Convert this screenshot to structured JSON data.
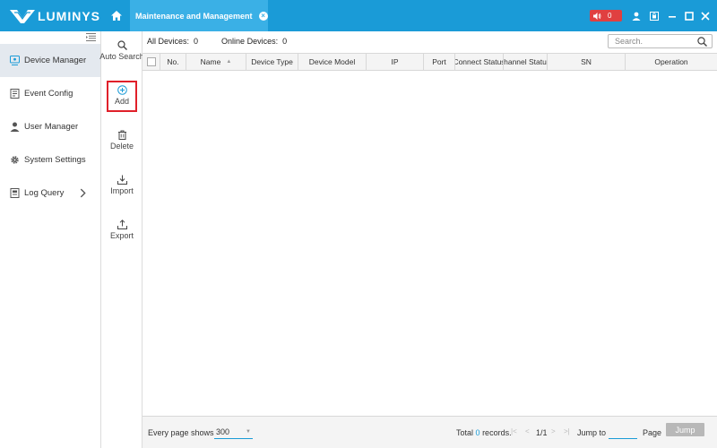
{
  "app": {
    "brand": "LUMINYS",
    "active_tab": "Maintenance and Management",
    "alarm_count": "0",
    "accent_color": "#1a9bd7"
  },
  "sidebar": {
    "items": [
      {
        "label": "Device Manager",
        "icon": "device-manager-icon",
        "active": true
      },
      {
        "label": "Event Config",
        "icon": "event-config-icon"
      },
      {
        "label": "User Manager",
        "icon": "user-icon"
      },
      {
        "label": "System Settings",
        "icon": "gear-icon"
      },
      {
        "label": "Log Query",
        "icon": "log-icon"
      }
    ]
  },
  "actions": {
    "auto_search": "Auto Search",
    "add": "Add",
    "delete": "Delete",
    "import": "Import",
    "export": "Export"
  },
  "stats": {
    "all_devices_label": "All Devices:",
    "all_devices_value": "0",
    "online_devices_label": "Online Devices:",
    "online_devices_value": "0"
  },
  "search": {
    "placeholder": "Search."
  },
  "table": {
    "columns": [
      "No.",
      "Name",
      "Device Type",
      "Device Model",
      "IP",
      "Port",
      "Connect Status",
      "hannel Statu",
      "SN",
      "Operation"
    ],
    "rows": []
  },
  "footer": {
    "page_size_label": "Every page shows",
    "page_size_value": "300",
    "total_prefix": "Total",
    "total_count": "0",
    "total_suffix": "records.",
    "page_indicator": "1/1",
    "jump_to_label": "Jump to",
    "page_label": "Page",
    "jump_button": "Jump"
  }
}
